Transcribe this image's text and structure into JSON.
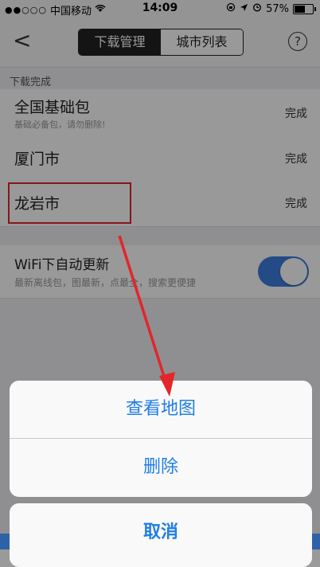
{
  "status_bar": {
    "carrier": "中国移动",
    "time": "14:09",
    "battery": "57%",
    "battery_level": 0.57
  },
  "nav": {
    "back_label": "<",
    "tabs": [
      {
        "label": "下载管理",
        "active": true
      },
      {
        "label": "城市列表",
        "active": false
      }
    ],
    "help_label": "?"
  },
  "downloads": {
    "section_title": "下载完成",
    "items": [
      {
        "title": "全国基础包",
        "subtitle": "基础必备包，请勿删除!",
        "status": "完成"
      },
      {
        "title": "厦门市",
        "status": "完成"
      },
      {
        "title": "龙岩市",
        "status": "完成"
      }
    ]
  },
  "wifi_update": {
    "title": "WiFi下自动更新",
    "subtitle": "最新离线包，图最新，点最全，搜索更便捷",
    "enabled": true
  },
  "action_sheet": {
    "view_map": "查看地图",
    "delete": "删除",
    "cancel": "取消"
  },
  "colors": {
    "accent": "#1f7ee6",
    "toggle_on": "#3d7de0",
    "highlight": "#e2262b"
  }
}
